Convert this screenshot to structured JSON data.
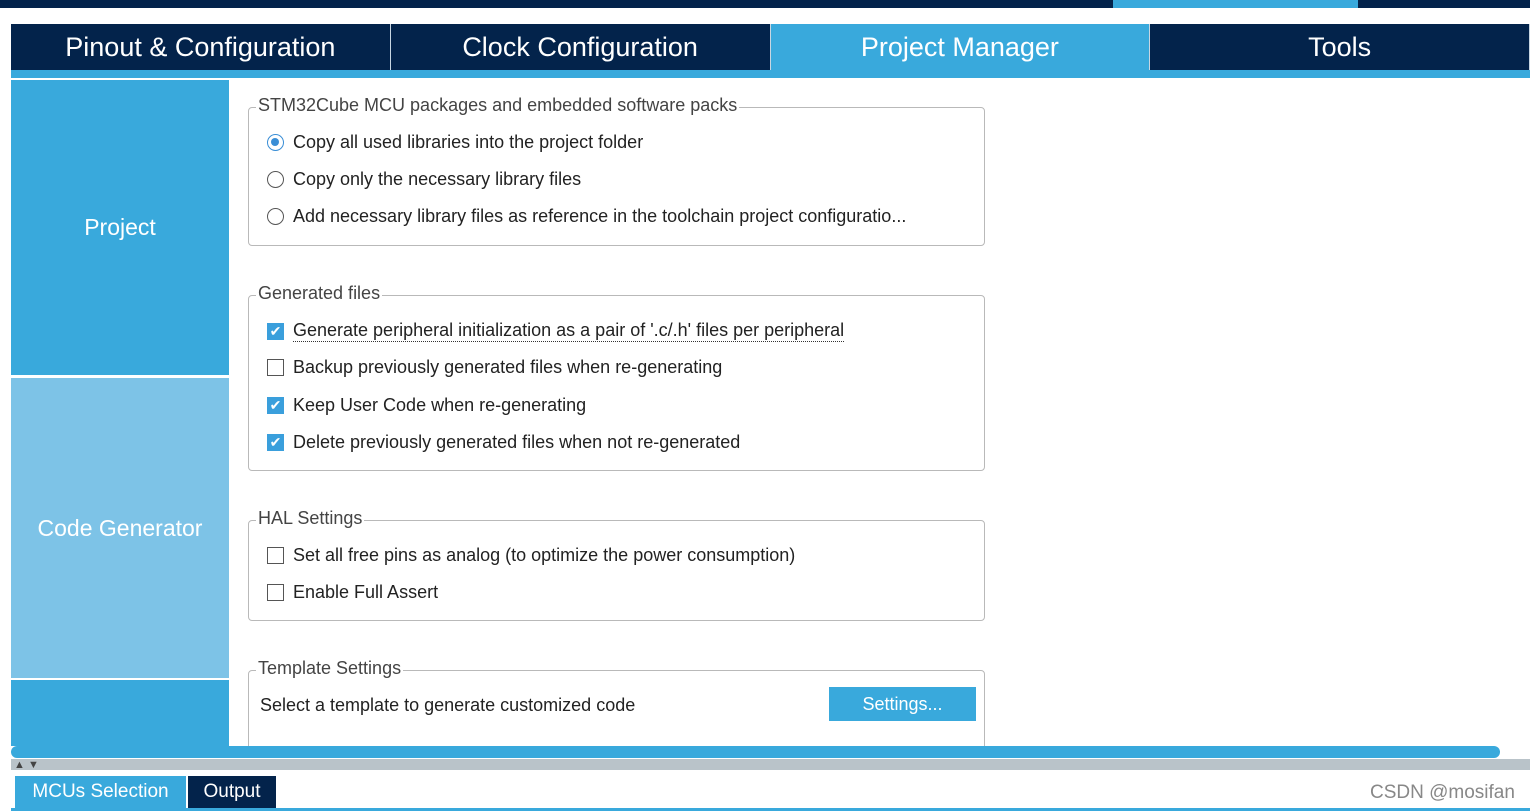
{
  "tabs": [
    "Pinout & Configuration",
    "Clock Configuration",
    "Project Manager",
    "Tools"
  ],
  "active_tab": "Project Manager",
  "sidebar": {
    "items": [
      "Project",
      "Code Generator"
    ]
  },
  "groups": {
    "packages": {
      "title": "STM32Cube MCU packages and embedded software packs",
      "options": [
        {
          "label": "Copy all used libraries into the project folder",
          "selected": true
        },
        {
          "label": "Copy only the necessary library files",
          "selected": false
        },
        {
          "label": "Add necessary library files as reference in the toolchain project configuratio...",
          "selected": false
        }
      ]
    },
    "generated": {
      "title": "Generated files",
      "options": [
        {
          "label": "Generate peripheral initialization as a pair of '.c/.h' files per peripheral",
          "checked": true
        },
        {
          "label": "Backup previously generated files when re-generating",
          "checked": false
        },
        {
          "label": "Keep User Code when re-generating",
          "checked": true
        },
        {
          "label": "Delete previously generated files when not re-generated",
          "checked": true
        }
      ]
    },
    "hal": {
      "title": "HAL Settings",
      "options": [
        {
          "label": "Set all free pins as analog (to optimize the power consumption)",
          "checked": false
        },
        {
          "label": "Enable Full Assert",
          "checked": false
        }
      ]
    },
    "template": {
      "title": "Template Settings",
      "text": "Select a template to generate customized code",
      "button": "Settings..."
    }
  },
  "bottom_tabs": [
    "MCUs Selection",
    "Output"
  ],
  "watermark": "CSDN @mosifan",
  "colors": {
    "navy": "#03234b",
    "accent": "#39a9dc",
    "sidebar_light": "#7dc3e7"
  }
}
